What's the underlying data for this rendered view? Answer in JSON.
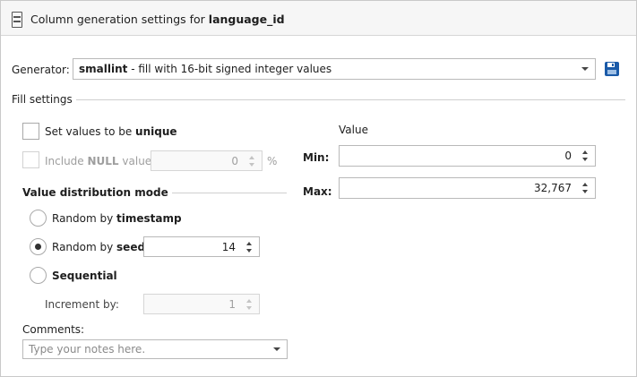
{
  "header": {
    "title_prefix": "Column generation settings for ",
    "column_name": "language_id"
  },
  "generator": {
    "label": "Generator:",
    "selected_name": "smallint",
    "selected_desc": " - fill with 16-bit signed integer values"
  },
  "fill_settings": {
    "group_label": "Fill settings",
    "unique": {
      "label_prefix": "Set values to be ",
      "label_bold": "unique",
      "checked": false
    },
    "include_null": {
      "label_prefix": "Include ",
      "label_bold": "NULL",
      "label_suffix": " values",
      "percent_value": "0",
      "percent_sign": "%",
      "checked": false,
      "enabled": false
    },
    "value": {
      "header": "Value",
      "min_label": "Min:",
      "min_value": "0",
      "max_label": "Max:",
      "max_value": "32,767"
    }
  },
  "distribution": {
    "group_label": "Value distribution mode",
    "timestamp": {
      "label_prefix": "Random by ",
      "label_bold": "timestamp",
      "selected": false
    },
    "seed": {
      "label_prefix": "Random by ",
      "label_bold": "seed",
      "value": "14",
      "selected": true
    },
    "sequential": {
      "label": "Sequential",
      "selected": false
    },
    "increment": {
      "label": "Increment by:",
      "value": "1",
      "enabled": false
    }
  },
  "comments": {
    "label": "Comments:",
    "placeholder": "Type your notes here."
  },
  "icons": {
    "header": "column-settings-icon",
    "save": "save-icon"
  },
  "colors": {
    "accent": "#1a5aa8",
    "header_bg": "#f6f6f6"
  }
}
